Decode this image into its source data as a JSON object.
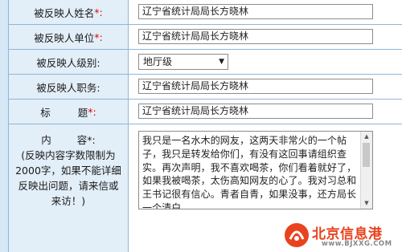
{
  "form": {
    "name": {
      "label": "被反映人姓名",
      "required_mark": "*:",
      "value": "辽宁省统计局局长方晓林"
    },
    "unit": {
      "label": "被反映人单位",
      "required_mark": "*:",
      "value": "辽宁省统计局局长方晓林"
    },
    "level": {
      "label": "被反映人级别:",
      "selected": "地厅级"
    },
    "position": {
      "label": "被反映人职务:",
      "value": "辽宁省统计局局长方晓林"
    },
    "title": {
      "label_left": "标",
      "label_right": "题",
      "required_mark": "*:",
      "value": "辽宁省统计局局长方晓林"
    },
    "content": {
      "label_left": "内",
      "label_right": "容",
      "required_mark": "*:",
      "note": "(反映内容字数限制为2000字，如果不能详细反映出问题，请来信或来访！)",
      "text": "我只是一名水木的网友，这两天非常火的一个帖子，我只是转发给你们，有没有这回事请组织查实。再次声明，我不喜欢喝茶，你们看着就好了，如果我被喝茶，太伤高知网友的心了。我对习总和王书记很有信心。青者自青，如果没事，还方局长一个清白。"
    }
  },
  "watermark": {
    "text": "北京信息港",
    "url": "www.BJXXG.COM"
  },
  "icons": {
    "dropdown": "triangle-down-icon",
    "scroll_up": "scroll-up-icon",
    "scroll_down": "scroll-down-icon",
    "logo": "bjxxg-logo-icon"
  },
  "colors": {
    "required": "#e60000",
    "watermark": "#e8431e",
    "border": "#8fb6d8"
  }
}
